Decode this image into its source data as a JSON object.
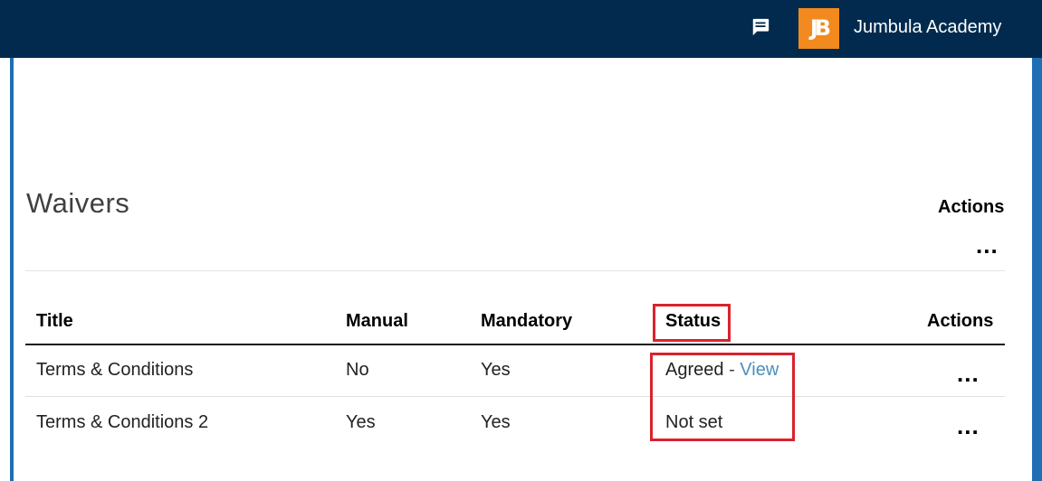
{
  "header": {
    "chat_icon": "chat-bubble-icon",
    "logo_text": "JB",
    "academy_name": "Jumbula Academy",
    "brand_colors": {
      "bar": "#022a4e",
      "logo": "#f28a1f",
      "rail": "#1f6fb5"
    }
  },
  "section": {
    "title": "Waivers",
    "actions_label": "Actions",
    "actions_menu": "..."
  },
  "table": {
    "columns": [
      "Title",
      "Manual",
      "Mandatory",
      "Status",
      "Actions"
    ],
    "rows": [
      {
        "title": "Terms & Conditions",
        "manual": "No",
        "mandatory": "Yes",
        "status": "Agreed",
        "status_separator": "-",
        "status_link": "View",
        "actions": "..."
      },
      {
        "title": "Terms & Conditions 2",
        "manual": "Yes",
        "mandatory": "Yes",
        "status": "Not set",
        "actions": "..."
      }
    ]
  },
  "highlight_color": "#d9232e"
}
